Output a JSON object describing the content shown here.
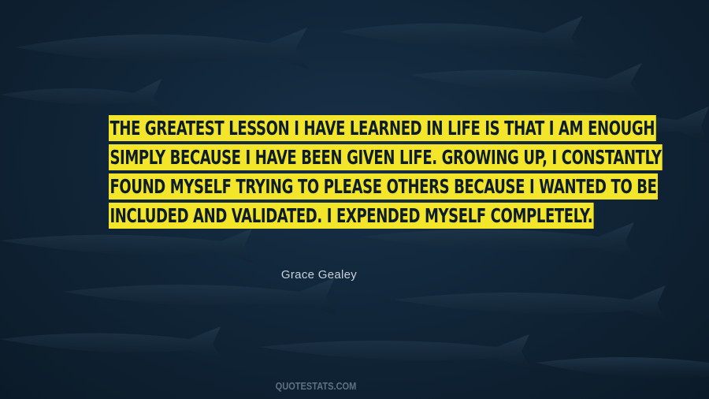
{
  "quote": {
    "lines": [
      "THE GREATEST LESSON I HAVE LEARNED IN LIFE IS THAT I AM ENOUGH",
      "SIMPLY BECAUSE I HAVE BEEN GIVEN LIFE. GROWING UP, I CONSTANTLY",
      "FOUND MYSELF TRYING TO PLEASE OTHERS BECAUSE I WANTED TO BE",
      "INCLUDED AND VALIDATED. I EXPENDED MYSELF COMPLETELY."
    ],
    "highlight_color": "#f2e52a",
    "text_color": "#0c1c2a"
  },
  "author": "Grace Gealey",
  "watermark": "QUOTESTATS.COM",
  "background": {
    "subject": "school of barracuda fish underwater",
    "color": "#112639"
  }
}
